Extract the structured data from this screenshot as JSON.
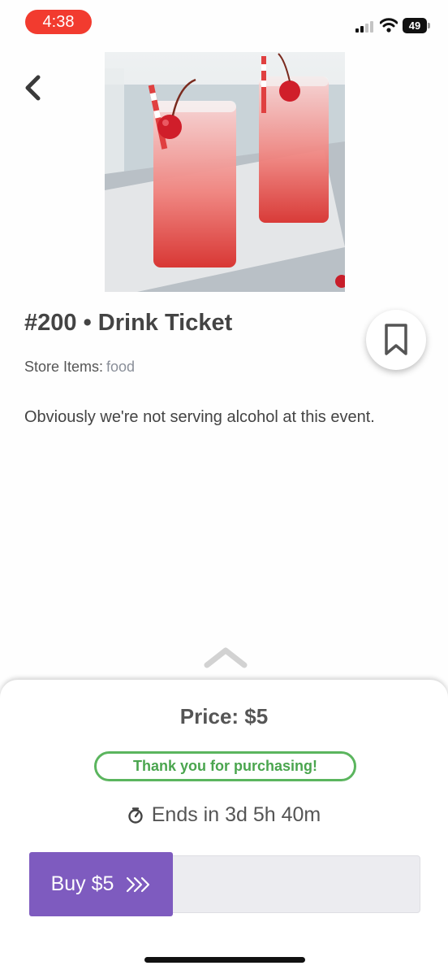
{
  "status_bar": {
    "time": "4:38",
    "battery": "49",
    "icons": [
      "cellular-signal-icon",
      "wifi-icon",
      "battery-icon"
    ]
  },
  "product": {
    "title": "#200 • Drink Ticket",
    "category_label": "Store Items:",
    "category_value": "food",
    "description": "Obviously we're not serving alcohol at this event.",
    "image": "cherry-soda-drinks-image"
  },
  "purchase": {
    "price": "Price: $5",
    "badge": "Thank you for purchasing!",
    "ends": "Ends in 3d 5h 40m",
    "buy_label": "Buy $5"
  },
  "colors": {
    "accent": "#7e5bbf",
    "success": "#5bb55e",
    "time_pill": "#f23b2f"
  }
}
